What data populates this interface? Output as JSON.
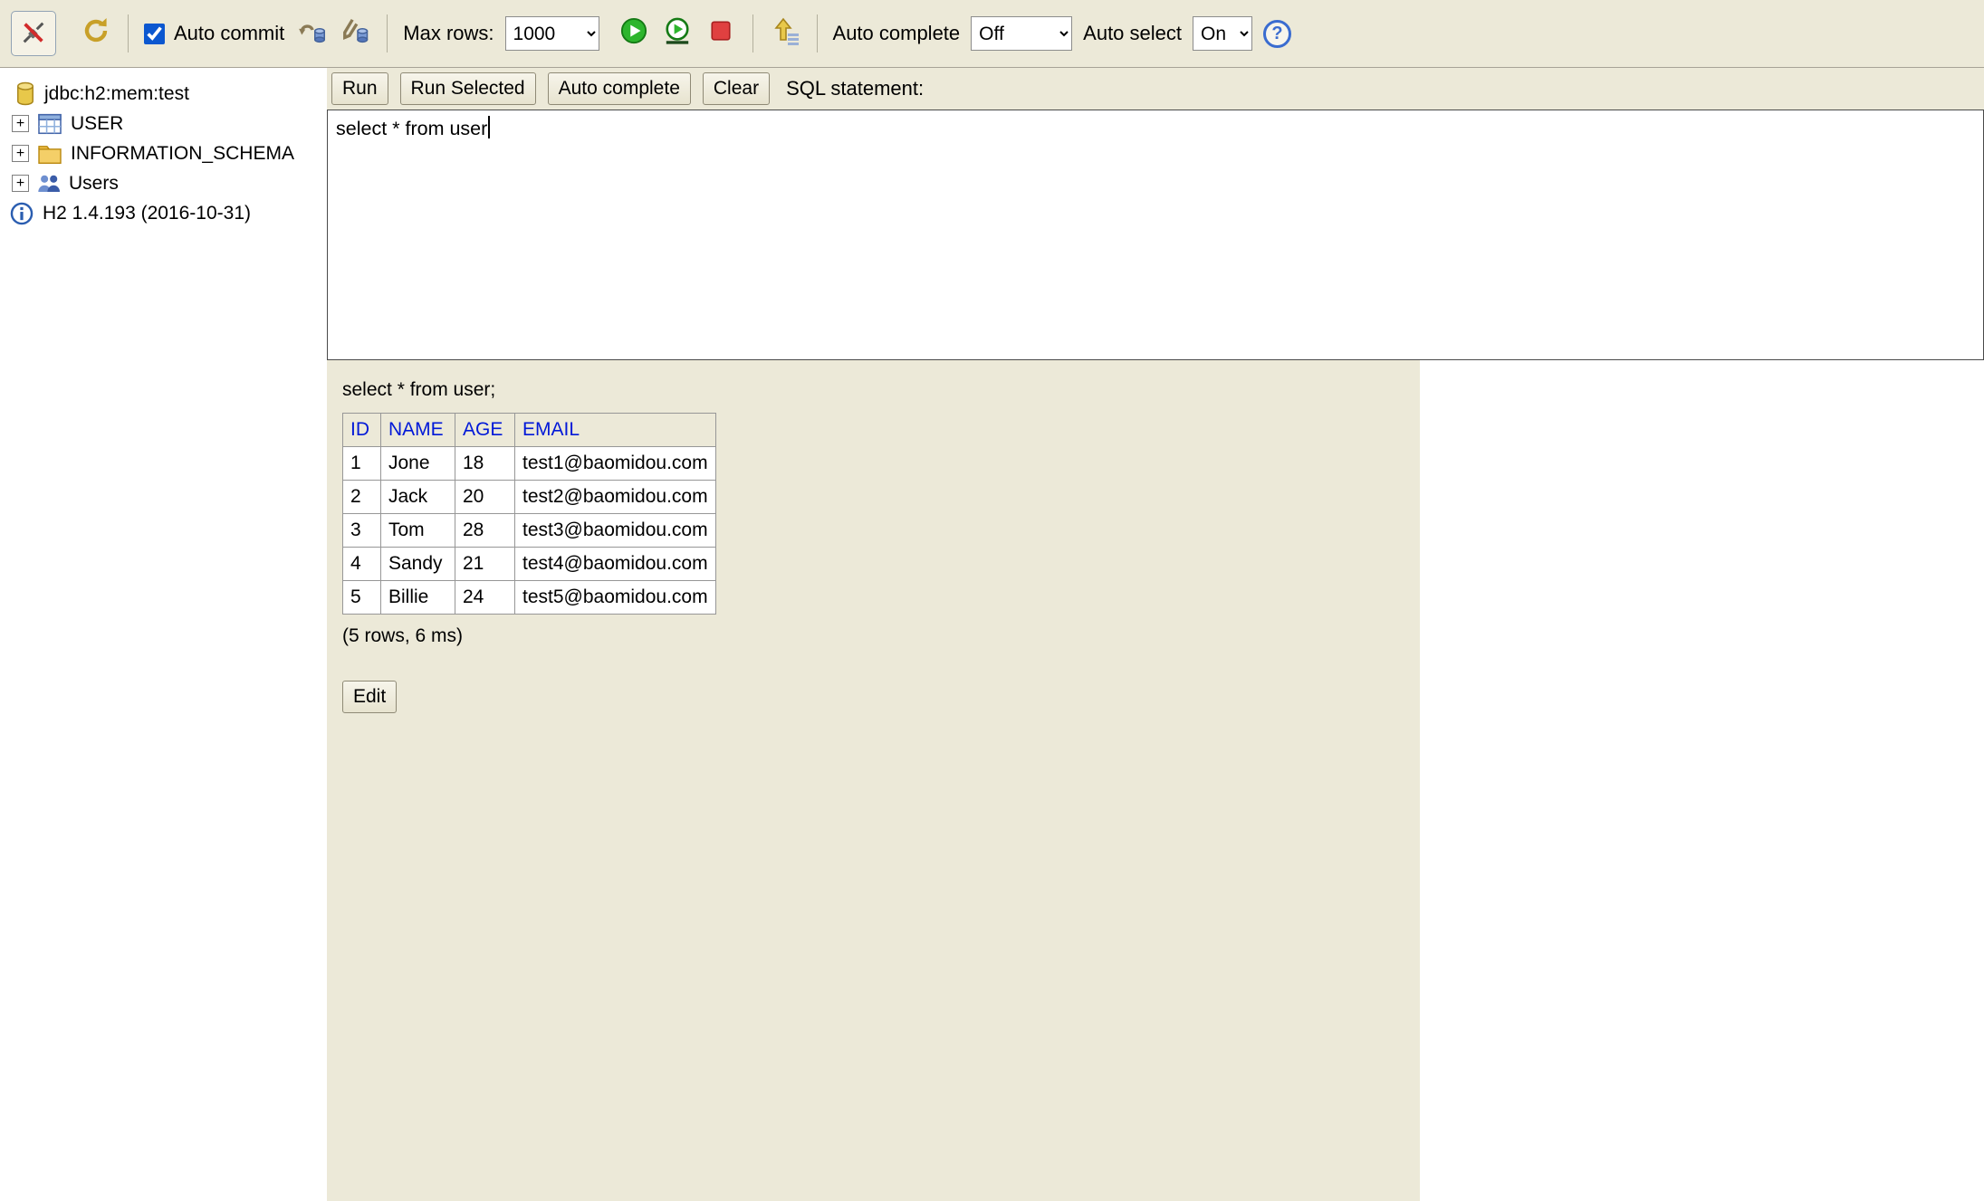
{
  "colors": {
    "toolbar_bg": "#ece9d8",
    "results_bg": "#ece9d8",
    "header_link_blue": "#0018d8",
    "run_green": "#2db52d",
    "stop_red": "#e04040",
    "checkbox_blue": "#0b57d0",
    "database_yellow": "#e8c84a"
  },
  "icons": {
    "toolbar": [
      "disconnect-icon",
      "refresh-icon",
      "commit-icon",
      "rollback-icon",
      "run-icon",
      "run-selected-icon",
      "stop-icon",
      "history-icon",
      "help-icon"
    ],
    "sidebar": [
      "database-icon",
      "table-icon",
      "folder-icon",
      "users-icon",
      "info-icon"
    ]
  },
  "toolbar": {
    "auto_commit_label": "Auto commit",
    "max_rows_label": "Max rows:",
    "max_rows_value": "1000",
    "auto_complete_label": "Auto complete",
    "auto_complete_value": "Off",
    "auto_select_label": "Auto select",
    "auto_select_value": "On",
    "help_label": "?"
  },
  "sidebar": {
    "expander_symbol": "+",
    "root": {
      "label": "jdbc:h2:mem:test"
    },
    "items": [
      {
        "label": "USER"
      },
      {
        "label": "INFORMATION_SCHEMA"
      },
      {
        "label": "Users"
      }
    ],
    "version": {
      "label": "H2 1.4.193 (2016-10-31)"
    }
  },
  "query": {
    "buttons": [
      "Run",
      "Run Selected",
      "Auto complete",
      "Clear"
    ],
    "statement_label": "SQL statement:",
    "sql_text": "select * from user"
  },
  "results": {
    "statement": "select * from user;",
    "table": {
      "headers": [
        "ID",
        "NAME",
        "AGE",
        "EMAIL"
      ],
      "rows": [
        [
          "1",
          "Jone",
          "18",
          "test1@baomidou.com"
        ],
        [
          "2",
          "Jack",
          "20",
          "test2@baomidou.com"
        ],
        [
          "3",
          "Tom",
          "28",
          "test3@baomidou.com"
        ],
        [
          "4",
          "Sandy",
          "21",
          "test4@baomidou.com"
        ],
        [
          "5",
          "Billie",
          "24",
          "test5@baomidou.com"
        ]
      ]
    },
    "status": "(5 rows, 6 ms)",
    "edit_button": "Edit"
  }
}
